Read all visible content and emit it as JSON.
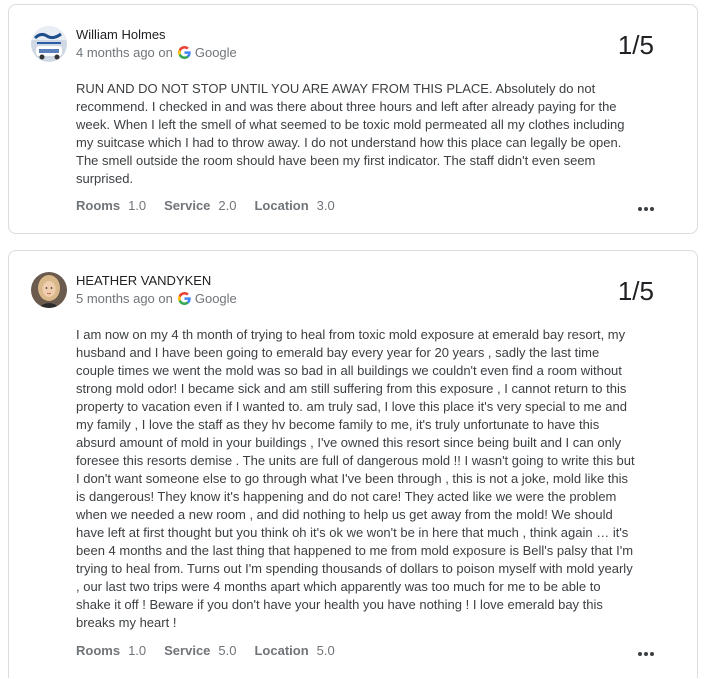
{
  "reviews": [
    {
      "reviewer": "William Holmes",
      "time": "4 months ago on",
      "source": "Google",
      "rating": "1/5",
      "text": "RUN AND DO NOT STOP UNTIL YOU ARE AWAY FROM THIS PLACE. Absolutely do not recommend. I checked in and was there about three hours and left after already paying for the week. When I left the smell of what seemed to be toxic mold permeated all my clothes including my suitcase which I had to throw away. I do not understand how this place can legally be open. The smell outside the room should have been my first indicator. The staff didn't even seem surprised.",
      "subratings": [
        {
          "label": "Rooms",
          "value": "1.0"
        },
        {
          "label": "Service",
          "value": "2.0"
        },
        {
          "label": "Location",
          "value": "3.0"
        }
      ],
      "avatar_icon": "user-photo-icon"
    },
    {
      "reviewer": "HEATHER VANDYKEN",
      "time": "5 months ago on",
      "source": "Google",
      "rating": "1/5",
      "text": "I am now on my 4 th month of trying to heal from toxic mold exposure at emerald bay resort, my husband and I have been going to emerald bay every year for 20 years , sadly the last time couple times we went the mold was so bad in all buildings we couldn't even find a room without strong mold odor! I became sick and am still suffering from this exposure , I cannot return to this property to vacation even if I wanted to. am truly sad, I love this place it's very special to me and my family , I love the staff as they hv become family to me, it's truly unfortunate to have this absurd amount of mold in your buildings , I've owned this resort since being built and I can only foresee this resorts demise . The units are full of dangerous mold !! I wasn't going to write this but I don't want someone else to go through what I've been through , this is not a joke, mold like this is dangerous! They know it's happening and do not care! They acted like we were the problem when we needed a new room , and did nothing to help us get away from the mold! We should have left at first thought but you think oh it's ok we won't be in here that much , think again … it's been 4 months and the last thing that happened to me from mold exposure is Bell's palsy that I'm trying to heal from. Turns out I'm spending thousands of dollars to poison myself with mold yearly , our last two trips were 4 months apart which apparently was too much for me to be able to shake it off ! Beware if you don't have your health you have nothing ! I love emerald bay this breaks my heart !",
      "subratings": [
        {
          "label": "Rooms",
          "value": "1.0"
        },
        {
          "label": "Service",
          "value": "5.0"
        },
        {
          "label": "Location",
          "value": "5.0"
        }
      ],
      "avatar_icon": "user-photo-icon"
    }
  ],
  "icons": {
    "google": "google-g-icon",
    "more": "more-options-icon"
  },
  "colors": {
    "google_blue": "#4285F4",
    "google_red": "#EA4335",
    "google_yellow": "#FBBC05",
    "google_green": "#34A853",
    "border": "#dadce0",
    "secondary_text": "#70757a"
  }
}
